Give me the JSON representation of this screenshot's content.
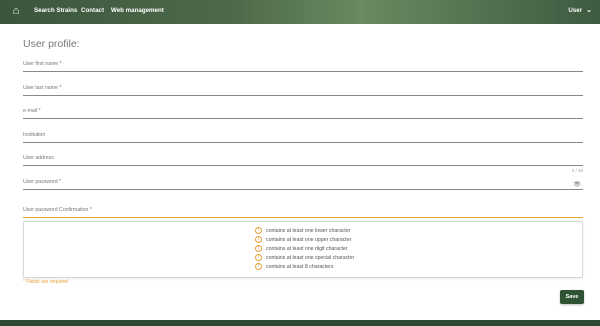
{
  "nav": {
    "home_icon": "home-icon",
    "links": [
      "Search Strains",
      "Contact",
      "Web management"
    ],
    "user_label": "User",
    "user_menu_icon": "chevron-down-icon"
  },
  "form": {
    "title": "User profile:",
    "fields": [
      {
        "label": "User first name *",
        "value": ""
      },
      {
        "label": "User last name *",
        "value": ""
      },
      {
        "label": "e-mail *",
        "value": ""
      },
      {
        "label": "Institution",
        "value": ""
      },
      {
        "label": "User address",
        "value": ""
      },
      {
        "label": "User password *",
        "value": ""
      },
      {
        "label": "User password Confirmation *",
        "value": ""
      }
    ],
    "password_counter": "0 / 20",
    "password_visibility_icon": "eye-off-icon",
    "rules": [
      "contains at least one lower character",
      "contains at least one upper character",
      "contains at least one digit character",
      "contains at least one special character",
      "contains at least 8 characters"
    ],
    "rule_icon": "warning-circle-icon",
    "required_note": "* Fields are required",
    "save_label": "Save"
  },
  "colors": {
    "brand_green": "#2f5434",
    "accent_orange": "#e6a23a"
  }
}
